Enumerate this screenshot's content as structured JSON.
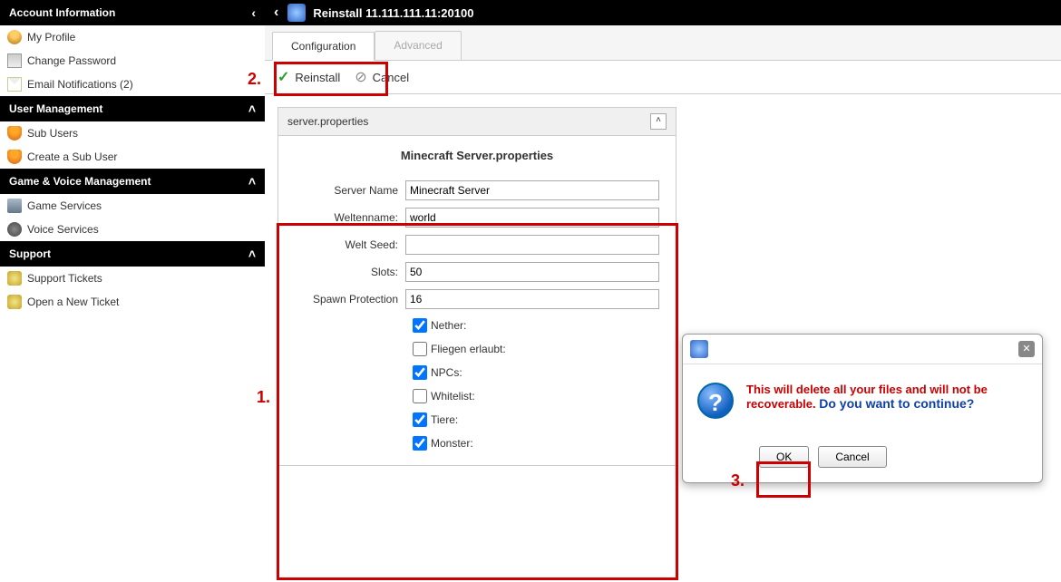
{
  "sidebar": {
    "account": {
      "header": "Account Information",
      "items": [
        {
          "label": "My Profile",
          "icon": "profile"
        },
        {
          "label": "Change Password",
          "icon": "pass"
        },
        {
          "label": "Email Notifications (2)",
          "icon": "mail"
        }
      ]
    },
    "user_mgmt": {
      "header": "User Management",
      "items": [
        {
          "label": "Sub Users",
          "icon": "user"
        },
        {
          "label": "Create a Sub User",
          "icon": "user"
        }
      ]
    },
    "game_voice": {
      "header": "Game & Voice Management",
      "items": [
        {
          "label": "Game Services",
          "icon": "game"
        },
        {
          "label": "Voice Services",
          "icon": "voice"
        }
      ]
    },
    "support": {
      "header": "Support",
      "items": [
        {
          "label": "Support Tickets",
          "icon": "lock"
        },
        {
          "label": "Open a New Ticket",
          "icon": "lock"
        }
      ]
    }
  },
  "header": {
    "title": "Reinstall 11.111.111.11:20100"
  },
  "tabs": {
    "config": "Configuration",
    "advanced": "Advanced"
  },
  "toolbar": {
    "reinstall": "Reinstall",
    "cancel": "Cancel"
  },
  "panel": {
    "head": "server.properties",
    "title": "Minecraft Server.properties",
    "fields": {
      "server_name": {
        "label": "Server Name",
        "value": "Minecraft Server"
      },
      "weltenname": {
        "label": "Weltenname:",
        "value": "world"
      },
      "welt_seed": {
        "label": "Welt Seed:",
        "value": ""
      },
      "slots": {
        "label": "Slots:",
        "value": "50"
      },
      "spawn": {
        "label": "Spawn Protection",
        "value": "16"
      }
    },
    "checks": {
      "nether": "Nether:",
      "fliegen": "Fliegen erlaubt:",
      "npcs": "NPCs:",
      "whitelist": "Whitelist:",
      "tiere": "Tiere:",
      "monster": "Monster:"
    }
  },
  "dialog": {
    "warn": "This will delete all your files and will not be recoverable.",
    "cont": "Do you want to continue?",
    "ok": "OK",
    "cancel": "Cancel"
  },
  "annot": {
    "one": "1.",
    "two": "2.",
    "three": "3."
  }
}
